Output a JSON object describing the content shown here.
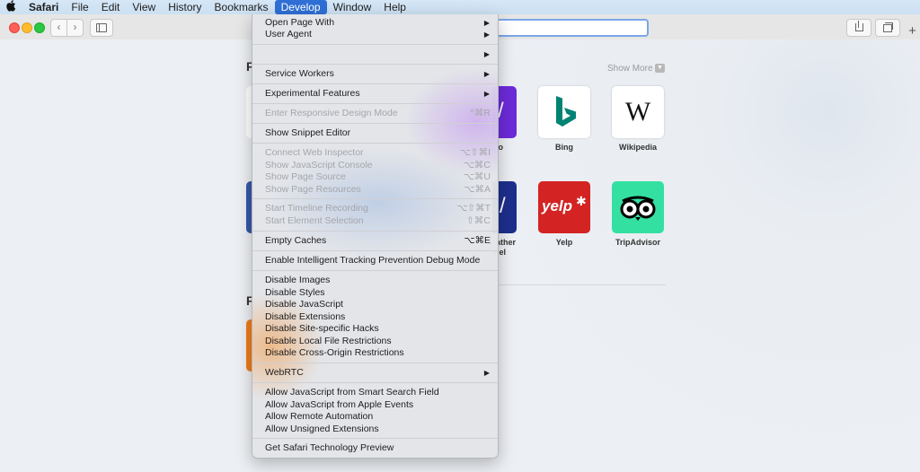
{
  "menubar": {
    "items": [
      "Safari",
      "File",
      "Edit",
      "View",
      "History",
      "Bookmarks",
      "Develop",
      "Window",
      "Help"
    ],
    "active": "Develop"
  },
  "page": {
    "show_more": "Show More",
    "section_favorites_partial": "F",
    "section_recent_partial": "F",
    "tiles": [
      {
        "label": "Bing"
      },
      {
        "label": "Wikipedia"
      },
      {
        "label": "Yelp"
      },
      {
        "label": "TripAdvisor"
      }
    ],
    "partial_labels": [
      "o",
      "ather",
      "nel"
    ],
    "wiki_glyph": "W",
    "yelp_glyph": "yelp",
    "purple_glyph": "/",
    "weather_glyph": "/"
  },
  "menu": {
    "items": [
      {
        "label": "Open Page With",
        "submenu": true
      },
      {
        "label": "User Agent",
        "submenu": true
      },
      {
        "label": "",
        "submenu": true
      },
      {
        "label": "Service Workers",
        "submenu": true
      },
      {
        "label": "Experimental Features",
        "submenu": true
      },
      {
        "label": "Enter Responsive Design Mode",
        "shortcut": "^⌘R",
        "disabled": true
      },
      {
        "label": "Show Snippet Editor"
      },
      {
        "label": "Connect Web Inspector",
        "shortcut": "⌥⇧⌘I",
        "disabled": true
      },
      {
        "label": "Show JavaScript Console",
        "shortcut": "⌥⌘C",
        "disabled": true
      },
      {
        "label": "Show Page Source",
        "shortcut": "⌥⌘U",
        "disabled": true
      },
      {
        "label": "Show Page Resources",
        "shortcut": "⌥⌘A",
        "disabled": true
      },
      {
        "label": "Start Timeline Recording",
        "shortcut": "⌥⇧⌘T",
        "disabled": true
      },
      {
        "label": "Start Element Selection",
        "shortcut": "⇧⌘C",
        "disabled": true
      },
      {
        "label": "Empty Caches",
        "shortcut": "⌥⌘E"
      },
      {
        "label": "Enable Intelligent Tracking Prevention Debug Mode"
      },
      {
        "label": "Disable Images"
      },
      {
        "label": "Disable Styles"
      },
      {
        "label": "Disable JavaScript"
      },
      {
        "label": "Disable Extensions"
      },
      {
        "label": "Disable Site-specific Hacks"
      },
      {
        "label": "Disable Local File Restrictions"
      },
      {
        "label": "Disable Cross-Origin Restrictions"
      },
      {
        "label": "WebRTC",
        "submenu": true
      },
      {
        "label": "Allow JavaScript from Smart Search Field"
      },
      {
        "label": "Allow JavaScript from Apple Events"
      },
      {
        "label": "Allow Remote Automation"
      },
      {
        "label": "Allow Unsigned Extensions"
      },
      {
        "label": "Get Safari Technology Preview"
      }
    ]
  },
  "colors": {
    "menu_highlight": "#2f6fd5",
    "yelp": "#d32323",
    "tripadvisor": "#34e0a1",
    "bing": "#008373"
  }
}
